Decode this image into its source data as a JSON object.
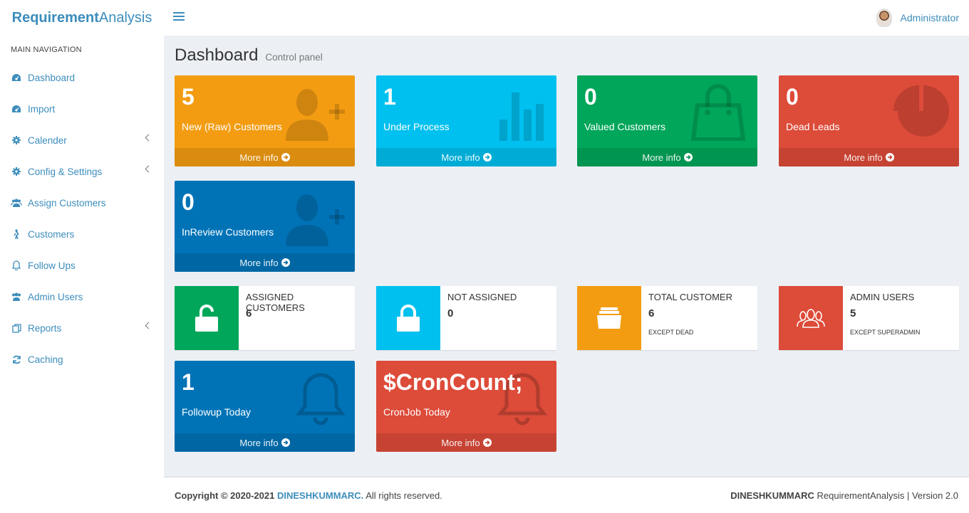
{
  "brand": {
    "bold": "Requirement",
    "light": "Analysis"
  },
  "header": {
    "user_name": "Administrator"
  },
  "sidebar": {
    "header": "MAIN NAVIGATION",
    "items": [
      {
        "label": "Dashboard",
        "icon": "dashboard-icon"
      },
      {
        "label": "Import",
        "icon": "dashboard-icon"
      },
      {
        "label": "Calender",
        "icon": "gear-icon"
      },
      {
        "label": "Config & Settings",
        "icon": "gear-icon"
      },
      {
        "label": "Assign Customers",
        "icon": "users-icon"
      },
      {
        "label": "Customers",
        "icon": "walking-icon"
      },
      {
        "label": "Follow Ups",
        "icon": "bell-icon"
      },
      {
        "label": "Admin Users",
        "icon": "users-icon"
      },
      {
        "label": "Reports",
        "icon": "copy-icon"
      },
      {
        "label": "Caching",
        "icon": "refresh-icon"
      }
    ]
  },
  "page": {
    "title": "Dashboard",
    "subtitle": "Control panel"
  },
  "boxes": [
    {
      "value": "5",
      "label": "New (Raw) Customers",
      "more": "More info",
      "color": "#f39c12"
    },
    {
      "value": "1",
      "label": "Under Process",
      "more": "More info",
      "color": "#00c0ef"
    },
    {
      "value": "0",
      "label": "Valued Customers",
      "more": "More info",
      "color": "#00a65a"
    },
    {
      "value": "0",
      "label": "Dead Leads",
      "more": "More info",
      "color": "#dd4b39"
    },
    {
      "value": "0",
      "label": "InReview Customers",
      "more": "More info",
      "color": "#0073b7"
    },
    {
      "value": "1",
      "label": "Followup Today",
      "more": "More info",
      "color": "#0073b7"
    },
    {
      "value": "$CronCount;",
      "label": "CronJob Today",
      "more": "More info",
      "color": "#dd4b39"
    }
  ],
  "info": [
    {
      "label": "ASSIGNED CUSTOMERS",
      "value": "6",
      "sub": "",
      "color": "#00a65a"
    },
    {
      "label": "NOT ASSIGNED",
      "value": "0",
      "sub": "",
      "color": "#00c0ef"
    },
    {
      "label": "TOTAL CUSTOMER",
      "value": "6",
      "sub": "EXCEPT DEAD",
      "color": "#f39c12"
    },
    {
      "label": "ADMIN USERS",
      "value": "5",
      "sub": "EXCEPT SUPERADMIN",
      "color": "#dd4b39"
    }
  ],
  "footer": {
    "copyright": "Copyright © 2020-2021 ",
    "author": "DINESHKUMMARC.",
    "rights": " All rights reserved.",
    "right_bold": "DINESHKUMMARC",
    "right_text": " RequirementAnalysis | Version 2.0"
  }
}
